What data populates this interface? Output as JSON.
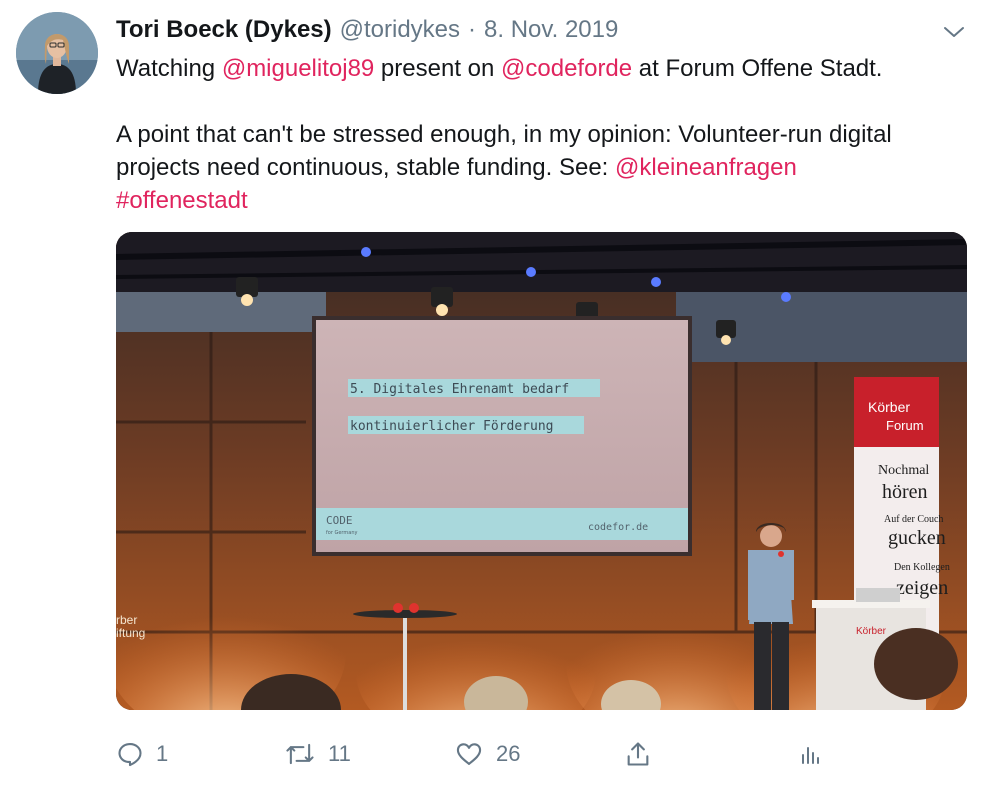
{
  "tweet": {
    "author": {
      "display_name": "Tori Boeck (Dykes)",
      "handle": "@toridykes"
    },
    "separator": "·",
    "date": "8. Nov. 2019",
    "text": {
      "line1_before": "Watching ",
      "mention1": "@miguelitoj89",
      "line1_middle": " present on ",
      "mention2": "@codeforde",
      "line1_after": " at Forum Offene Stadt.",
      "para2": "A point that can't be stressed enough, in my opinion: Volunteer-run digital projects need continuous, stable funding. See: ",
      "mention3": "@kleineanfragen",
      "hashtag": "#offenestadt"
    },
    "media": {
      "slide_line1": "5. Digitales Ehrenamt bedarf",
      "slide_line2": "kontinuierlicher Förderung",
      "slide_logo": "CODE",
      "slide_logo_sub": "for Germany",
      "slide_url": "codefor.de",
      "banner_brand_line1": "Körber",
      "banner_brand_line2": "Forum",
      "banner_line1": "Nochmal",
      "banner_line2": "hören",
      "banner_line3": "Auf der Couch",
      "banner_line4": "gucken",
      "banner_line5": "Den Kollegen",
      "banner_line6": "zeigen",
      "podium_label": "Körber",
      "wall_text_line1": "rber",
      "wall_text_line2": "iftung"
    },
    "actions": {
      "reply_count": "1",
      "retweet_count": "11",
      "like_count": "26"
    },
    "icons": {
      "reply": "reply-icon",
      "retweet": "retweet-icon",
      "like": "heart-icon",
      "share": "share-icon",
      "analytics": "analytics-icon",
      "more": "chevron-down-icon"
    },
    "colors": {
      "link": "#e0245e",
      "muted": "#657786",
      "text": "#14171a"
    }
  }
}
